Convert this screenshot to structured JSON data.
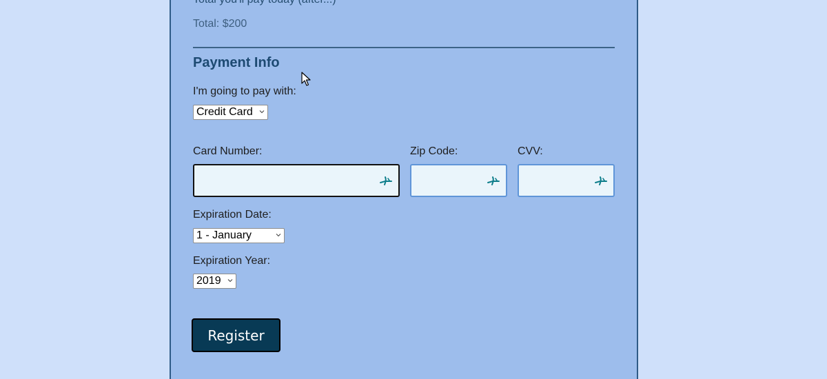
{
  "order": {
    "cut_text": "Total you'll pay today (after...)",
    "total_label": "Total: $200"
  },
  "payment": {
    "heading": "Payment Info",
    "pay_with_label": "I'm going to pay with:",
    "pay_with_selected": "Credit Card",
    "card_number_label": "Card Number:",
    "zip_label": "Zip Code:",
    "cvv_label": "CVV:",
    "card_number_value": "",
    "zip_value": "",
    "cvv_value": "",
    "exp_date_label": "Expiration Date:",
    "exp_date_selected": "1 - January",
    "exp_year_label": "Expiration Year:",
    "exp_year_selected": "2019"
  },
  "actions": {
    "register_label": "Register"
  },
  "icons": {
    "select_chevron": "chevron-down-icon",
    "input_helper": "autofill-icon",
    "cursor": "mouse-pointer-icon"
  },
  "colors": {
    "page_background": "#cfe0fa",
    "panel_background": "#9dbdec",
    "input_background": "#eaf5fb",
    "input_border": "#5f95d8",
    "button_background": "#083a55",
    "heading": "#1d4a72"
  }
}
